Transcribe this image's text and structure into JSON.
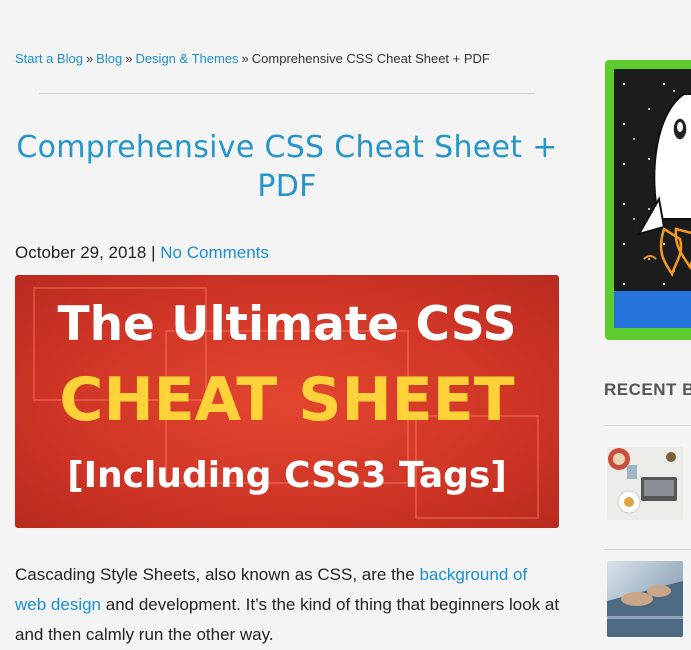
{
  "breadcrumb": {
    "items": [
      "Start a Blog",
      "Blog",
      "Design & Themes"
    ],
    "separator": "»",
    "current": "Comprehensive CSS Cheat Sheet + PDF"
  },
  "post": {
    "title": "Comprehensive CSS Cheat Sheet + PDF",
    "date": "October 29, 2018",
    "meta_separator": "|",
    "comments": "No Comments",
    "hero": {
      "line1": "The Ultimate CSS",
      "line2": "CHEAT SHEET",
      "line3": "[Including CSS3 Tags]",
      "bg_color": "#d63b29",
      "accent_color": "#ffd23a"
    },
    "body": {
      "text_before_link": "Cascading Style Sheets, also known as CSS, are the ",
      "link": "background of web design",
      "text_after_link": " and development. It’s the kind of thing that beginners look at and then calmly run the other way."
    }
  },
  "sidebar": {
    "recent_title": "RECENT BI",
    "promo_button_color": "#2673db",
    "promo_border_color": "#5ccc2f",
    "thumbnails": [
      "food-laptop-image",
      "typing-laptop-image"
    ]
  },
  "colors": {
    "link": "#1b8fd1",
    "title": "#2596c9"
  }
}
